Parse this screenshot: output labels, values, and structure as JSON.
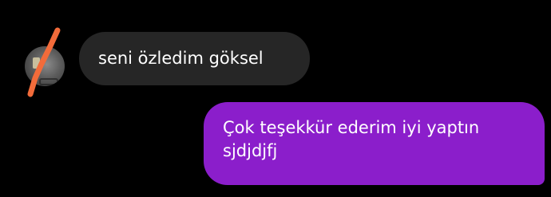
{
  "conversation": {
    "incoming_message": {
      "text": "seni özledim göksel",
      "bubble_color": "#262626"
    },
    "outgoing_message": {
      "lines": [
        "Çok teşekkür ederim iyi yaptın",
        "sjdjdjfj"
      ],
      "bubble_color": "#8b1ecb"
    },
    "sender_avatar": {
      "icon": "profile-photo",
      "redaction_mark_color": "#f26b3a"
    }
  },
  "theme": {
    "background": "#000000",
    "text_color": "#ffffff"
  }
}
